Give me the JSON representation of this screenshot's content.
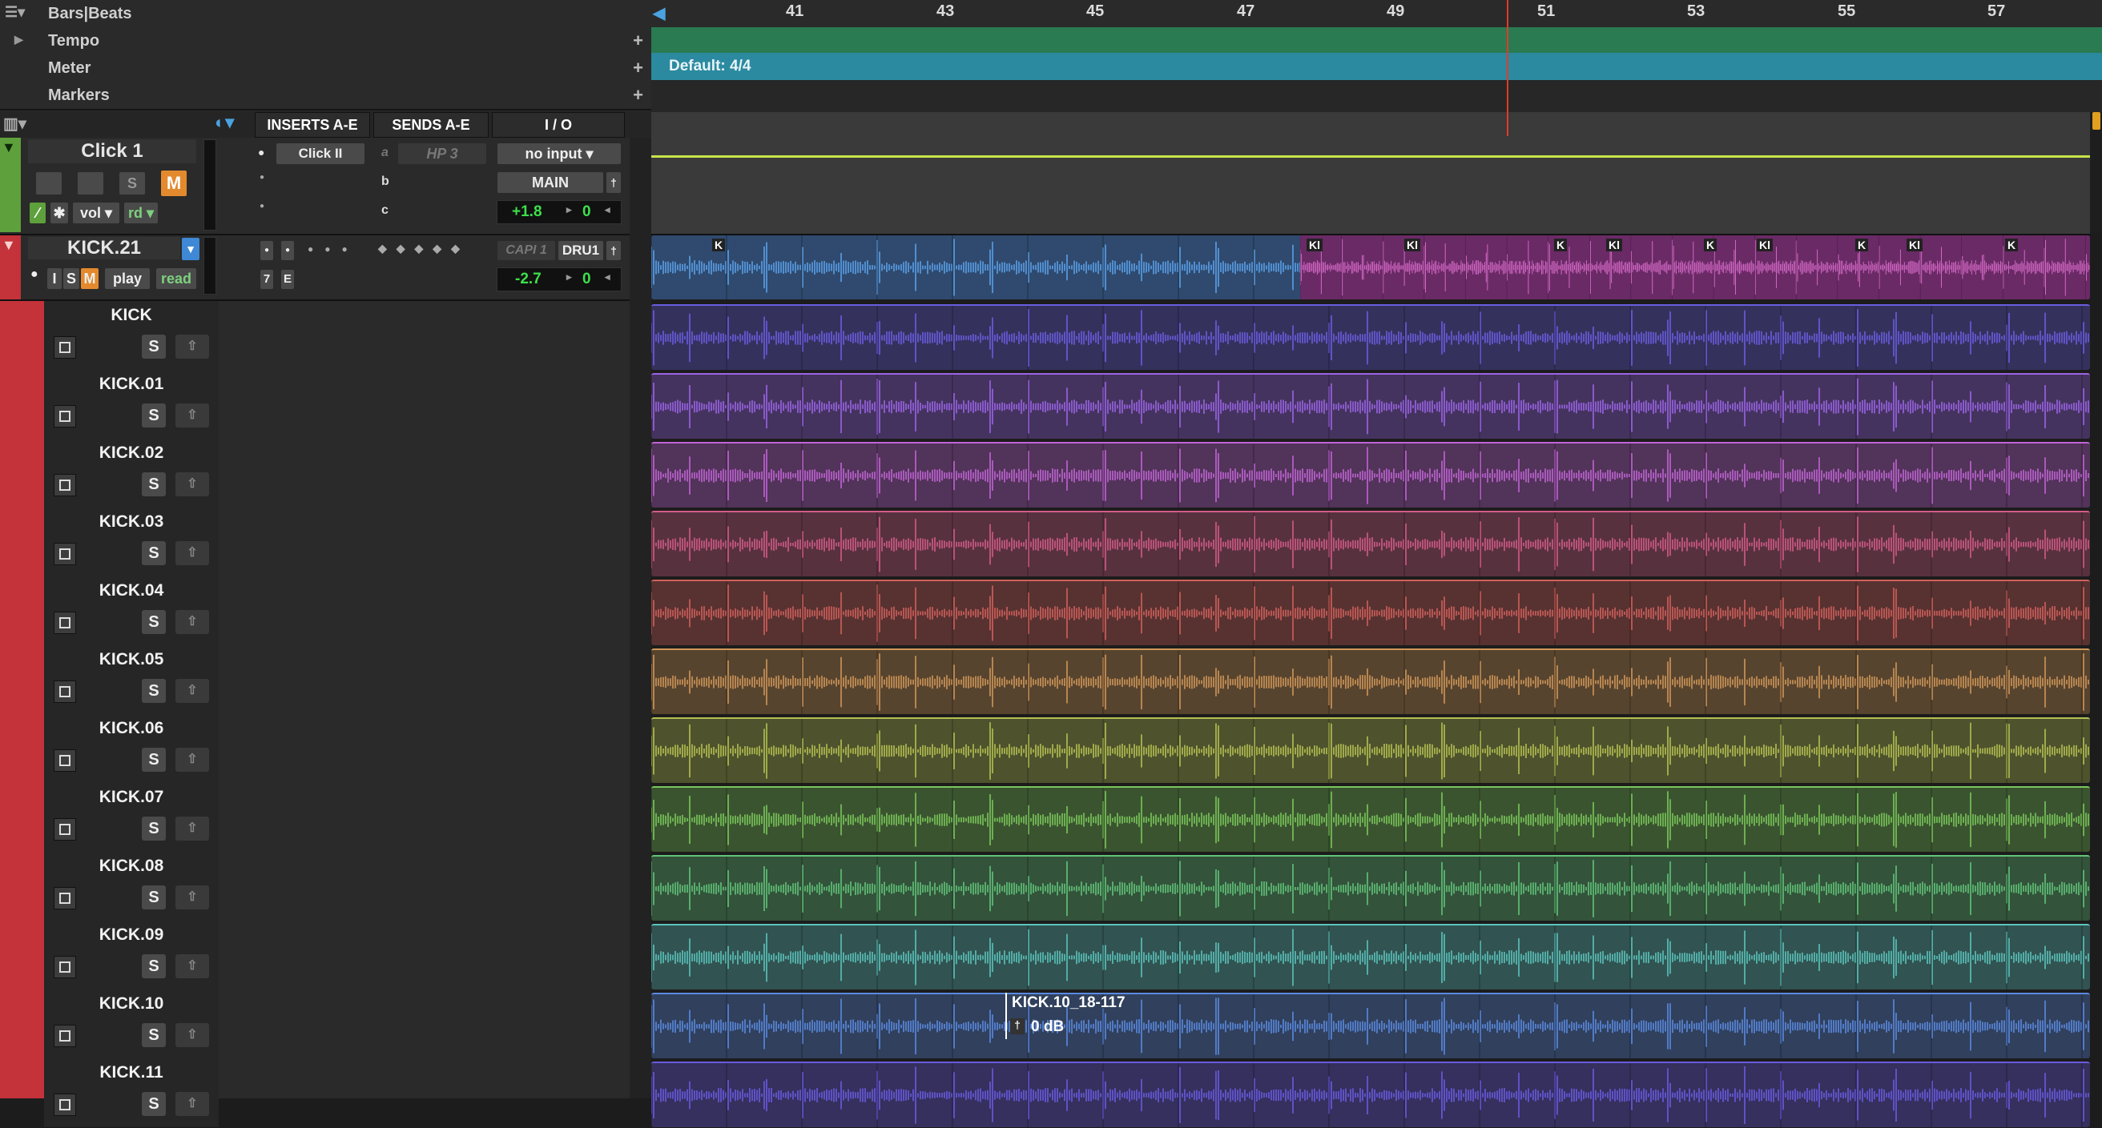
{
  "ruler": {
    "bars_beats_label": "Bars|Beats",
    "rows": [
      {
        "label": "Tempo",
        "expand": "▶"
      },
      {
        "label": "Meter"
      },
      {
        "label": "Markers"
      }
    ],
    "add_symbol": "+",
    "bar_numbers": [
      "41",
      "43",
      "45",
      "47",
      "49",
      "51",
      "53",
      "55",
      "57"
    ],
    "meter_text": "Default: 4/4"
  },
  "mix_headers": {
    "inserts": "INSERTS A-E",
    "sends": "SENDS A-E",
    "io": "I / O"
  },
  "click_track": {
    "name": "Click 1",
    "solo": "S",
    "mute": "M",
    "view": "vol",
    "automation": "rd",
    "insert": "Click II",
    "send_a_letter": "a",
    "send_a": "HP 3",
    "send_b_letter": "b",
    "send_c_letter": "c",
    "input": "no input",
    "output": "MAIN",
    "volume": "+1.8",
    "pan": "0"
  },
  "kick_track": {
    "name": "KICK.21",
    "input_btn": "I",
    "solo": "S",
    "mute": "M",
    "playlist": "play",
    "automation": "read",
    "voice_num": "7",
    "edit_btn": "E",
    "input": "CAPI 1",
    "output": "DRU1",
    "volume": "-2.7",
    "pan": "0"
  },
  "playlists": [
    {
      "name": "KICK",
      "color": "#6a5ee0"
    },
    {
      "name": "KICK.01",
      "color": "#9a64e6"
    },
    {
      "name": "KICK.02",
      "color": "#c064d6"
    },
    {
      "name": "KICK.03",
      "color": "#d25c86"
    },
    {
      "name": "KICK.04",
      "color": "#d0605c"
    },
    {
      "name": "KICK.05",
      "color": "#cf9658"
    },
    {
      "name": "KICK.06",
      "color": "#b4c052"
    },
    {
      "name": "KICK.07",
      "color": "#7ac75a"
    },
    {
      "name": "KICK.08",
      "color": "#62c47a"
    },
    {
      "name": "KICK.09",
      "color": "#5cc4bc"
    },
    {
      "name": "KICK.10",
      "color": "#5a8ae0"
    },
    {
      "name": "KICK.11",
      "color": "#6a5ae0"
    }
  ],
  "playlist_solo": "S",
  "clip_tooltip": {
    "name": "KICK.10_18-117",
    "gain": "0 dB"
  },
  "clip_marks": [
    "K",
    "Kl",
    "Kl",
    "K",
    "Kl",
    "K",
    "Kl",
    "K",
    "Kl",
    "K"
  ],
  "colors": {
    "click_accent": "#5da03c",
    "kick_accent": "#c4323a",
    "tempo_bar": "#2a7a52",
    "meter_bar": "#2b8aa0",
    "playhead": "#e23a2a"
  }
}
